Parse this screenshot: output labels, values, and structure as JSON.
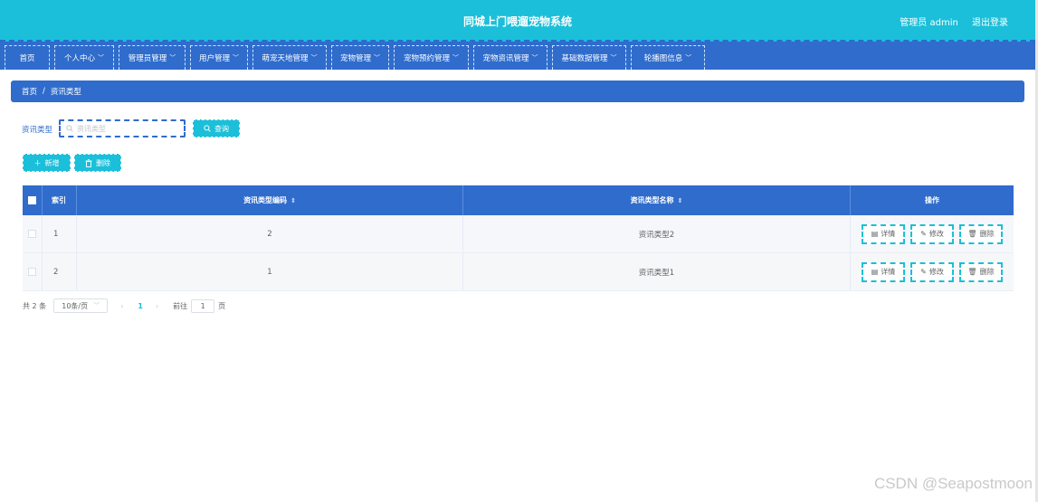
{
  "header": {
    "title": "同城上门喂遛宠物系统",
    "user_text": "管理员 admin",
    "logout_label": "退出登录"
  },
  "nav": [
    {
      "label": "首页",
      "dropdown": false
    },
    {
      "label": "个人中心",
      "dropdown": true
    },
    {
      "label": "管理员管理",
      "dropdown": true
    },
    {
      "label": "用户管理",
      "dropdown": true
    },
    {
      "label": "萌宠天地管理",
      "dropdown": true
    },
    {
      "label": "宠物管理",
      "dropdown": true
    },
    {
      "label": "宠物预约管理",
      "dropdown": true
    },
    {
      "label": "宠物资讯管理",
      "dropdown": true
    },
    {
      "label": "基础数据管理",
      "dropdown": true
    },
    {
      "label": "轮播图信息",
      "dropdown": true
    }
  ],
  "breadcrumb": {
    "home": "首页",
    "separator": "/",
    "current": "资讯类型"
  },
  "search": {
    "label": "资讯类型",
    "placeholder": "资讯类型",
    "value": "",
    "button_label": "查询"
  },
  "actions": {
    "add_label": "新增",
    "delete_label": "删除"
  },
  "table": {
    "columns": {
      "index": "索引",
      "code": "资讯类型编码",
      "name": "资讯类型名称",
      "ops": "操作"
    },
    "rows": [
      {
        "index": "1",
        "code": "2",
        "name": "资讯类型2"
      },
      {
        "index": "2",
        "code": "1",
        "name": "资讯类型1"
      }
    ],
    "row_actions": {
      "detail": "详情",
      "edit": "修改",
      "delete": "删除"
    }
  },
  "pagination": {
    "total_text": "共 2 条",
    "page_size": "10条/页",
    "prev": "‹",
    "current_page": "1",
    "next": "›",
    "goto_label": "前往",
    "goto_value": "1",
    "goto_suffix": "页"
  },
  "watermark": "CSDN @Seapostmoon",
  "colors": {
    "accent": "#1bbfd9",
    "primary": "#2f6ccc"
  }
}
